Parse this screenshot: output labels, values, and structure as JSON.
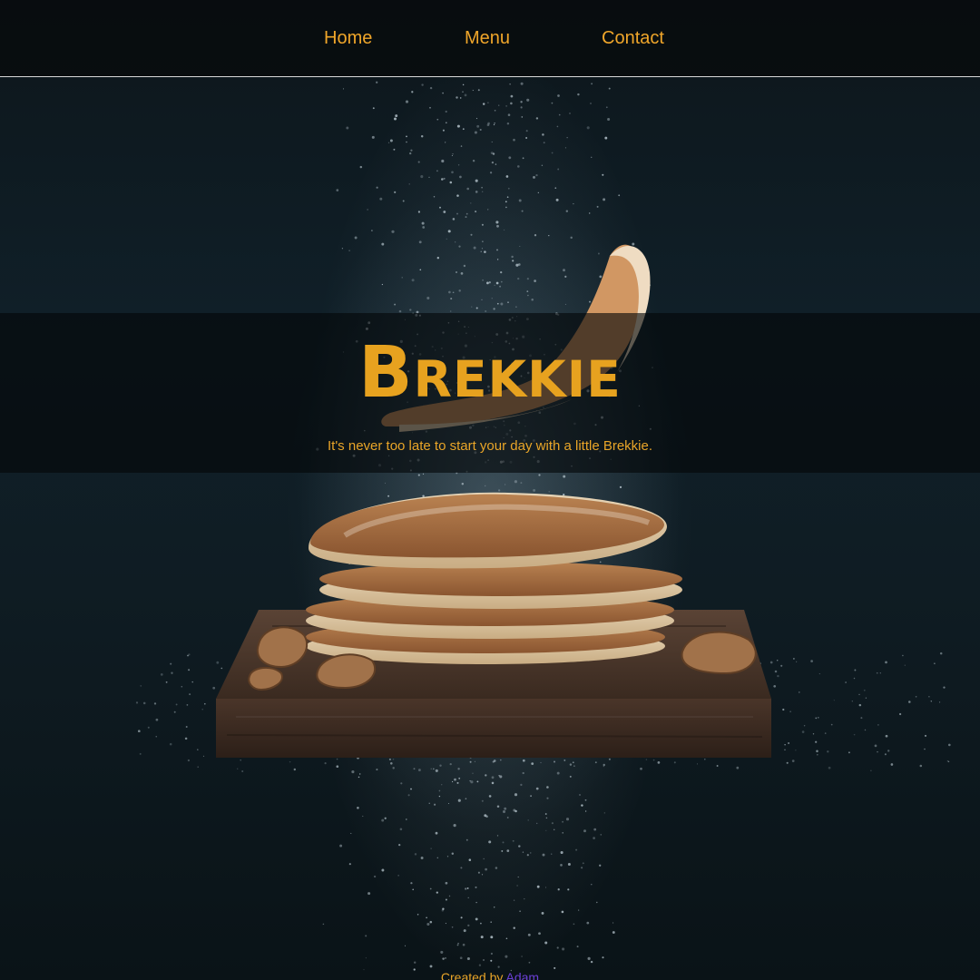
{
  "nav": {
    "items": [
      {
        "label": "Home"
      },
      {
        "label": "Menu"
      },
      {
        "label": "Contact"
      }
    ]
  },
  "hero": {
    "title": "Brekkie",
    "tagline": "It's never too late to start your day with a little Brekkie."
  },
  "footer": {
    "prefix": "Created by",
    "author": "Adam"
  },
  "colors": {
    "accent": "#e7a21f",
    "link": "#6b3fd6",
    "background": "#0f1c23"
  }
}
